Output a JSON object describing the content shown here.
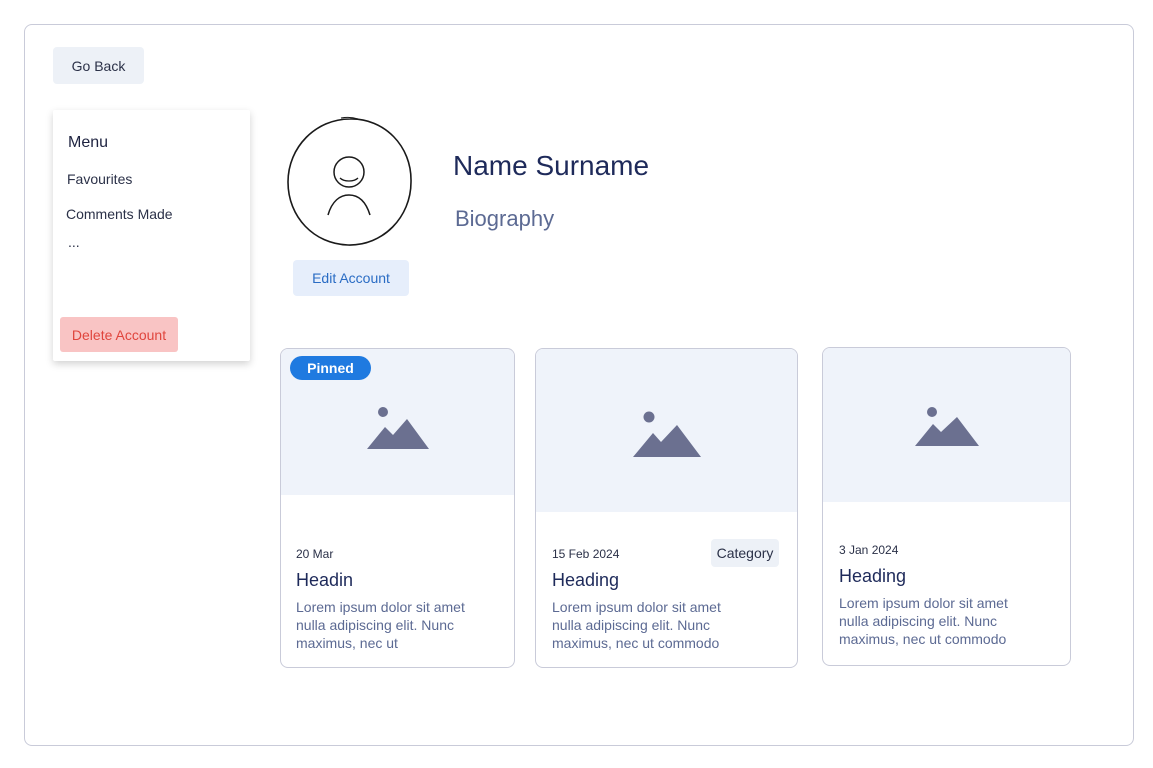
{
  "nav": {
    "go_back_label": "Go Back"
  },
  "menu": {
    "title": "Menu",
    "items": [
      {
        "label": "Favourites"
      },
      {
        "label": "Comments Made"
      },
      {
        "label": "..."
      }
    ],
    "delete_label": "Delete Account"
  },
  "profile": {
    "name": "Name Surname",
    "biography": "Biography",
    "edit_label": "Edit Account"
  },
  "cards": [
    {
      "badge": "Pinned",
      "date": "20 Mar",
      "heading": "Headin",
      "body": "Lorem ipsum dolor sit amet nulla adipiscing elit. Nunc maximus, nec ut"
    },
    {
      "category": "Category",
      "date": "15 Feb 2024",
      "heading": "Heading",
      "body": "Lorem ipsum dolor sit amet nulla adipiscing elit. Nunc maximus, nec ut commodo"
    },
    {
      "date": "3 Jan 2024",
      "heading": "Heading",
      "body": "Lorem ipsum dolor sit amet nulla adipiscing elit. Nunc maximus, nec ut commodo"
    }
  ],
  "icons": {
    "avatar": "user-avatar-icon",
    "image_placeholder": "image-placeholder-icon"
  },
  "colors": {
    "primary": "#1f7ae0",
    "danger": "#e0453d",
    "danger_bg": "#f9c4c4",
    "placeholder_bg": "#eff3fa",
    "placeholder_icon": "#6b7090",
    "heading_text": "#1e2a5a"
  }
}
